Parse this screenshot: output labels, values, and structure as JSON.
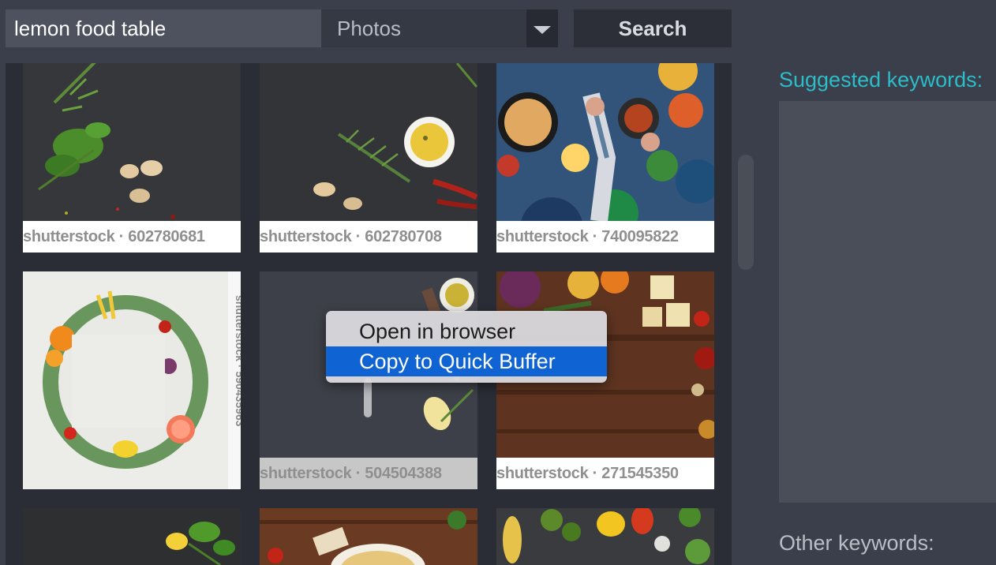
{
  "search": {
    "query": "lemon food table",
    "type_selected": "Photos",
    "button_label": "Search"
  },
  "results": [
    {
      "caption": "shutterstock · 602780681",
      "icon": "photo-herbs-garlic-dark-stone"
    },
    {
      "caption": "shutterstock · 602780708",
      "icon": "photo-olive-oil-rosemary-chili"
    },
    {
      "caption": "shutterstock · 740095822",
      "icon": "photo-table-people-food-overhead"
    },
    {
      "caption": "shutterstock · 590435963",
      "icon": "photo-vegetable-frame-white-card"
    },
    {
      "caption": "shutterstock · 504504388",
      "icon": "photo-dark-stone-oil-lemon"
    },
    {
      "caption": "shutterstock · 271545350",
      "icon": "photo-wooden-table-spices"
    },
    {
      "caption": "",
      "icon": "photo-basil-lemon-dark"
    },
    {
      "caption": "",
      "icon": "photo-hummus-bowl-wood"
    },
    {
      "caption": "",
      "icon": "photo-vegetables-dark-stone"
    }
  ],
  "context_menu": {
    "items": [
      {
        "label": "Open in browser"
      },
      {
        "label": "Copy to Quick Buffer"
      }
    ]
  },
  "sidebar": {
    "suggested_title": "Suggested keywords:",
    "other_title": "Other keywords:"
  },
  "colors": {
    "background": "#3b3f4b",
    "accent": "#2bbdc8",
    "menu_highlight": "#0f63d2"
  }
}
